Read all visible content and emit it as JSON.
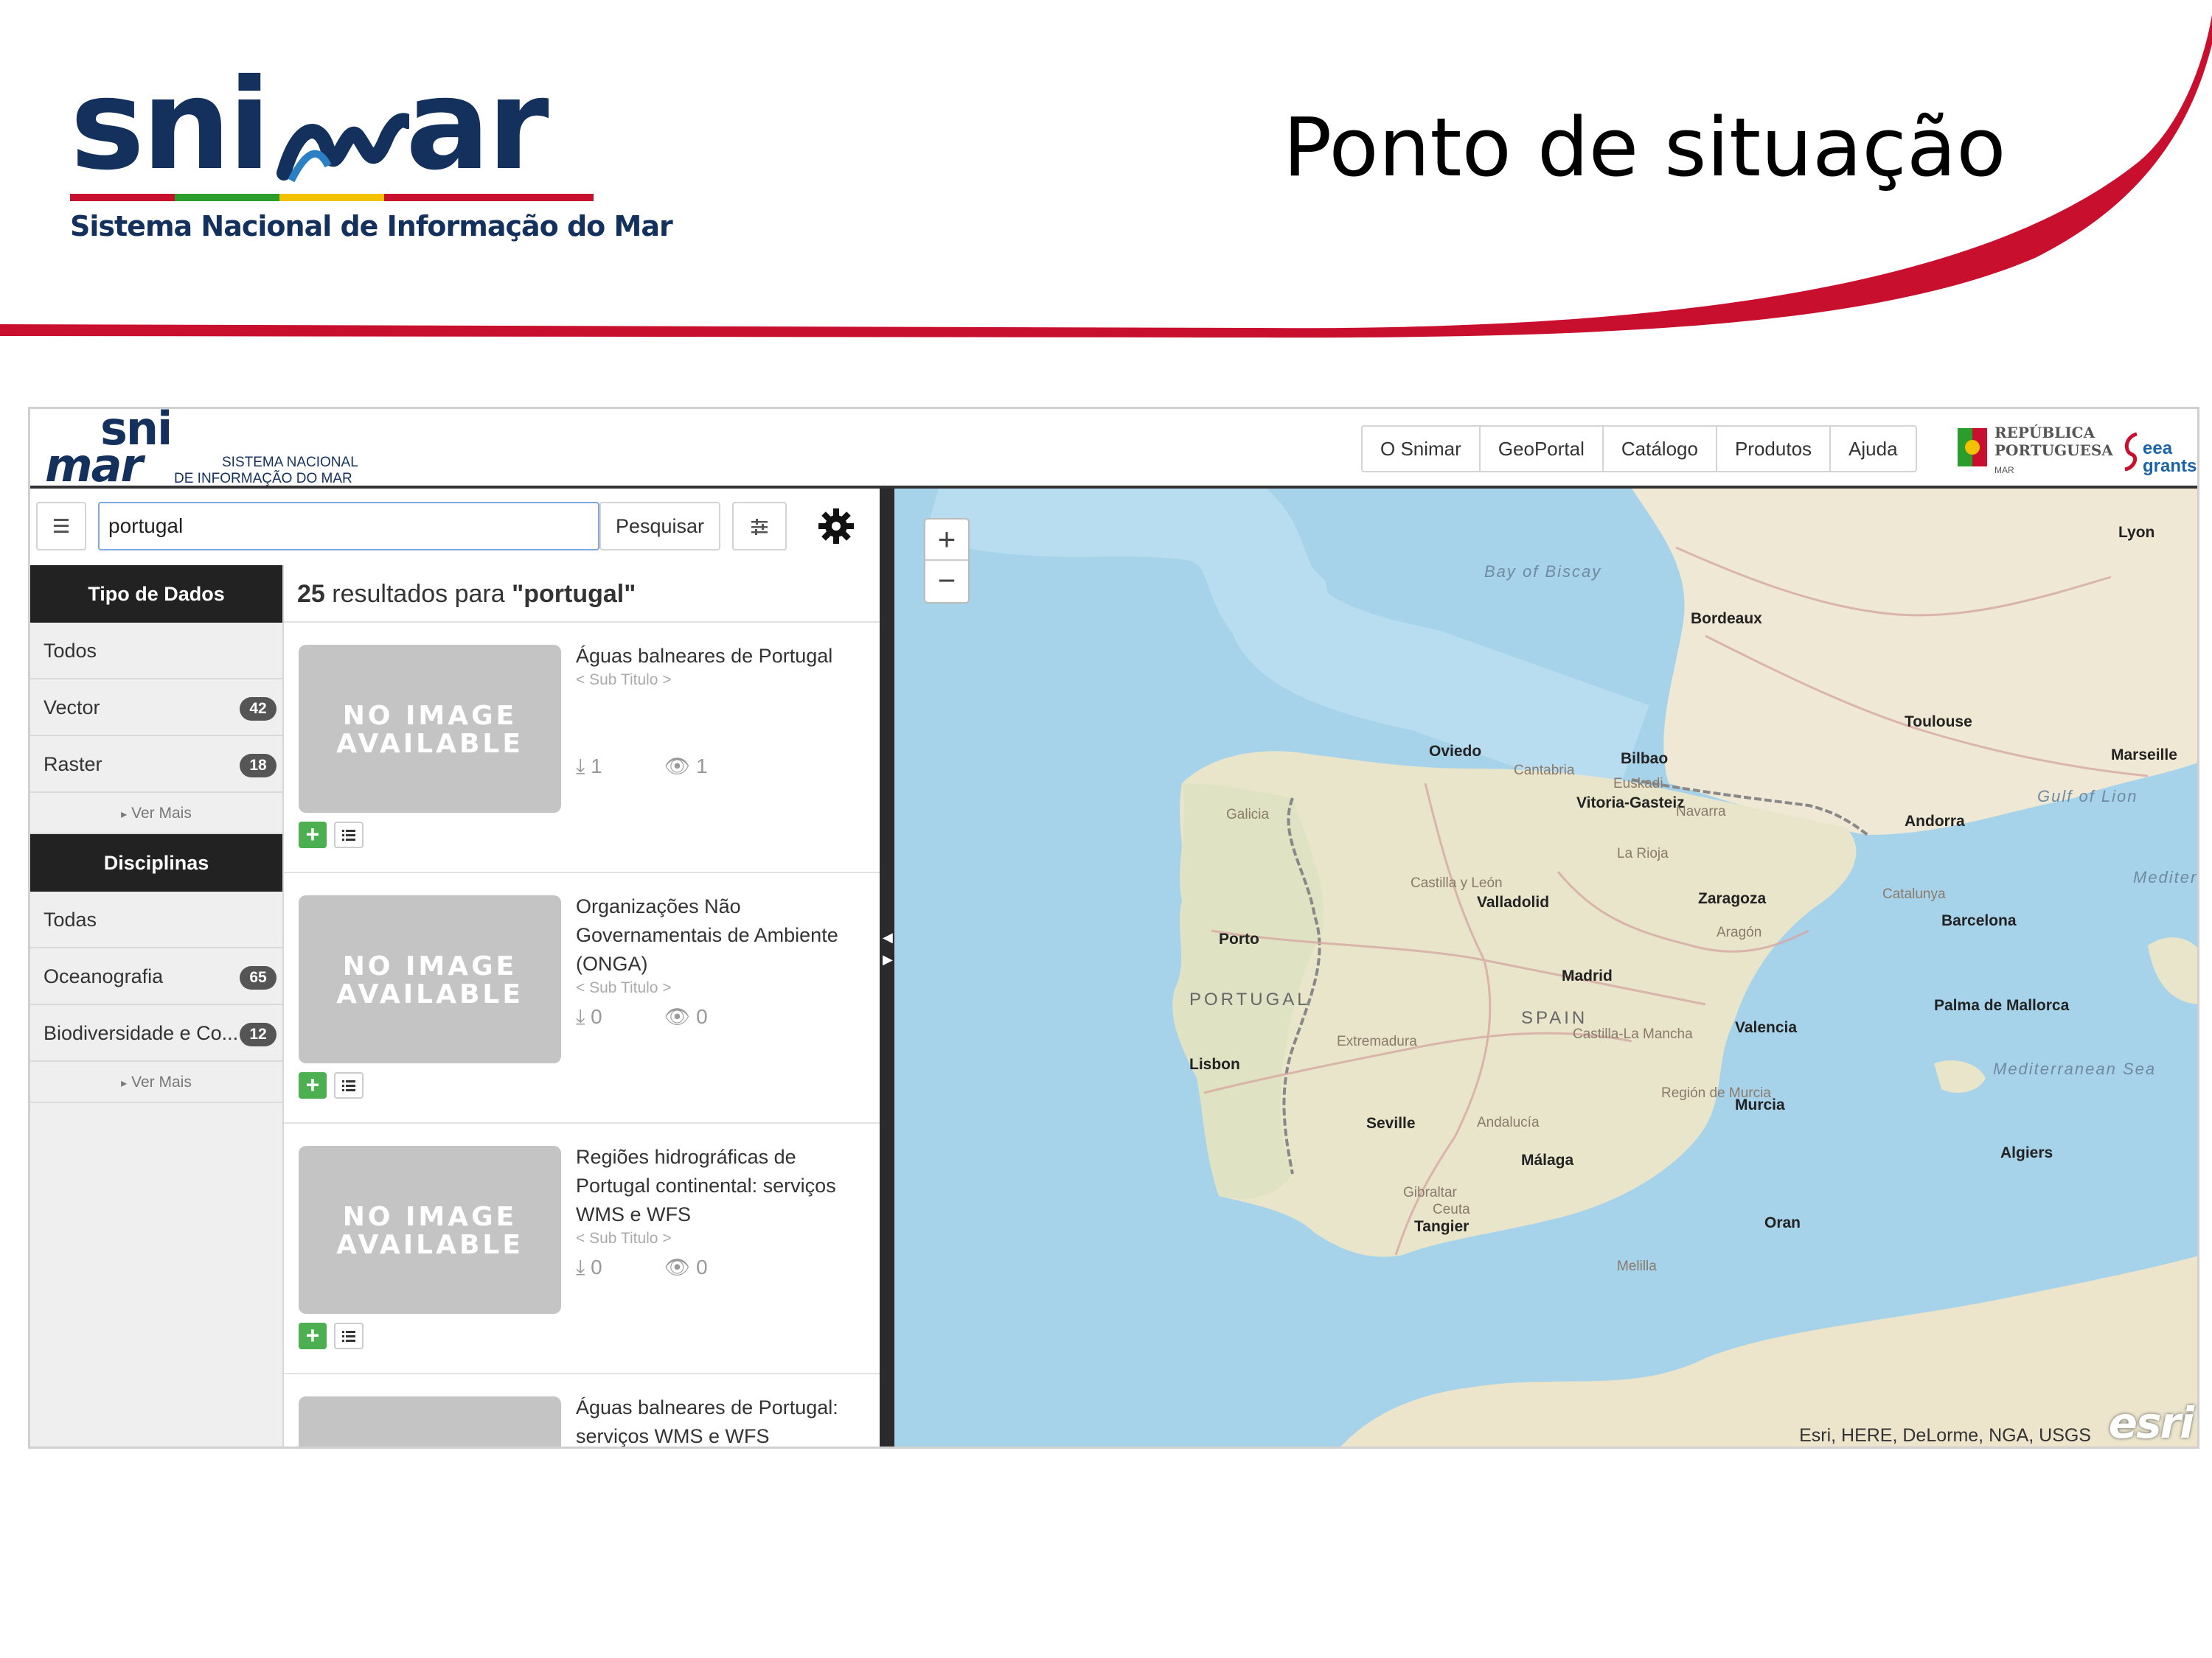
{
  "slide": {
    "title": "Ponto de situação",
    "logo_text_left": "sni",
    "logo_text_right": "ar",
    "logo_subtitle": "Sistema Nacional de Informação do Mar",
    "accent_color": "#c8102e",
    "logo_color": "#13315c"
  },
  "app": {
    "logo": {
      "sni": "sni",
      "mar": "mar",
      "line1": "SISTEMA NACIONAL",
      "line2": "DE INFORMAÇÃO DO MAR"
    },
    "nav": [
      "O Snimar",
      "GeoPortal",
      "Catálogo",
      "Produtos",
      "Ajuda"
    ],
    "partner_logo": {
      "line1": "REPÚBLICA",
      "line2": "PORTUGUESA",
      "small": "MAR"
    },
    "eea_logo": {
      "line1": "eea",
      "line2": "grants"
    },
    "search": {
      "value": "portugal",
      "button": "Pesquisar"
    },
    "sidebar": {
      "data_types": {
        "title": "Tipo de Dados",
        "items": [
          {
            "label": "Todos",
            "count": ""
          },
          {
            "label": "Vector",
            "count": "42"
          },
          {
            "label": "Raster",
            "count": "18"
          }
        ],
        "more": "Ver Mais"
      },
      "disciplines": {
        "title": "Disciplinas",
        "items": [
          {
            "label": "Todas",
            "count": ""
          },
          {
            "label": "Oceanografia",
            "count": "65"
          },
          {
            "label": "Biodiversidade e Co...",
            "count": "12"
          }
        ],
        "more": "Ver Mais"
      }
    },
    "results": {
      "count": "25",
      "text": "resultados para",
      "query": "\"portugal\"",
      "no_image_line1": "NO IMAGE",
      "no_image_line2": "AVAILABLE",
      "items": [
        {
          "title": "Águas balneares de Portugal",
          "subtitle": "< Sub Titulo >",
          "downloads": "1",
          "views": "1"
        },
        {
          "title": "Organizações Não Governamentais de Ambiente (ONGA)",
          "subtitle": "< Sub Titulo >",
          "downloads": "0",
          "views": "0"
        },
        {
          "title": "Regiões hidrográficas de Portugal continental: serviços WMS e WFS",
          "subtitle": "< Sub Titulo >",
          "downloads": "0",
          "views": "0"
        },
        {
          "title": "Águas balneares de Portugal: serviços WMS e WFS",
          "subtitle": "",
          "downloads": "",
          "views": ""
        }
      ]
    },
    "map": {
      "zoom_in": "+",
      "zoom_out": "−",
      "attribution": "Esri, HERE, DeLorme, NGA, USGS",
      "esri": "esri",
      "labels": {
        "bay_of_biscay": "Bay of Biscay",
        "bordeaux": "Bordeaux",
        "lyon": "Lyon",
        "toulouse": "Toulouse",
        "marseille": "Marseille",
        "gulf_of_lion": "Gulf of Lion",
        "mediterra_sea": "Mediterra Sea",
        "oviedo": "Oviedo",
        "bilbao": "Bilbao",
        "cantabria": "Cantabria",
        "euskadi": "Euskadi",
        "vitoria": "Vitoria-Gasteiz",
        "navarra": "Navarra",
        "andorra": "Andorra",
        "galicia": "Galicia",
        "la_rioja": "La Rioja",
        "castilla_leon": "Castilla y León",
        "valladolid": "Valladolid",
        "zaragoza": "Zaragoza",
        "catalunya": "Catalunya",
        "aragon": "Aragón",
        "barcelona": "Barcelona",
        "porto": "Porto",
        "madrid": "Madrid",
        "portugal": "PORTUGAL",
        "spain": "SPAIN",
        "extremadura": "Extremadura",
        "castilla_la_mancha": "Castilla-La Mancha",
        "valencia": "Valencia",
        "palma": "Palma de Mallorca",
        "lisbon": "Lisbon",
        "mediterranean_sea": "Mediterranean Sea",
        "murcia": "Murcia",
        "region_murcia": "Región de Murcia",
        "seville": "Seville",
        "andalucia": "Andalucía",
        "malaga": "Málaga",
        "gibraltar": "Gibraltar",
        "ceuta": "Ceuta",
        "tangier": "Tangier",
        "oran": "Oran",
        "algiers": "Algiers",
        "melilla": "Melilla"
      }
    }
  }
}
